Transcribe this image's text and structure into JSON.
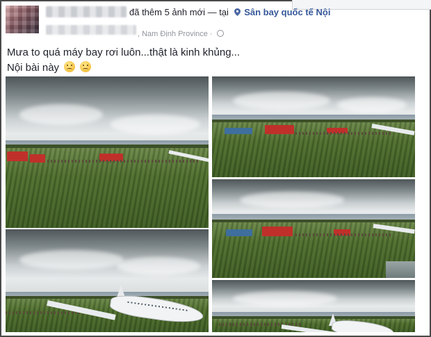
{
  "post": {
    "header_action": "đã thêm 5 ảnh mới — tại",
    "action_count": "5",
    "location": "Sân bay quốc tế Nội",
    "sub_location": ", Nam Định Province ·",
    "text_line1": "Mưa to quá máy bay rơi luôn...thật là kinh khủng...",
    "text_line2": "Nội bài này",
    "emoji_1": "disappointed-face-emoji",
    "emoji_2": "disappointed-face-emoji"
  },
  "icons": {
    "location": "map-pin-icon",
    "privacy": "globe-icon"
  },
  "colors": {
    "link_blue": "#365899",
    "muted_text": "#90949c",
    "fire_truck_red": "#c0302a",
    "grass_green": "#4f6e2f"
  },
  "photos": [
    {
      "id": "photo-1",
      "description_name": "grassy field with fire trucks"
    },
    {
      "id": "photo-2",
      "description_name": "field with trucks under cloudy sky"
    },
    {
      "id": "photo-3",
      "description_name": "rescue vehicles near wing"
    },
    {
      "id": "photo-4",
      "description_name": "crashed airplane in grass"
    },
    {
      "id": "photo-5",
      "description_name": "airplane tail in field"
    }
  ]
}
